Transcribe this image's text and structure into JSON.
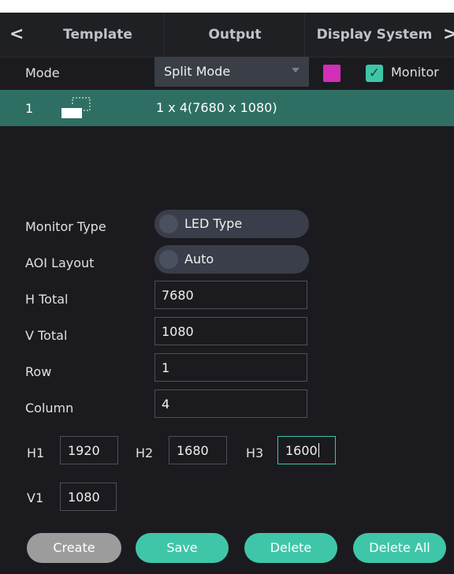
{
  "tabs": {
    "back_glyph": "<",
    "forward_glyph": ">",
    "items": [
      "Template",
      "Output",
      "Display System"
    ]
  },
  "mode": {
    "label": "Mode",
    "selected": "Split Mode",
    "color_swatch": "#d12fb8",
    "monitor_checked": true,
    "monitor_label": "Monitor"
  },
  "layout_list": {
    "rows": [
      {
        "index": "1",
        "description": "1 x 4(7680 x 1080)"
      }
    ]
  },
  "settings": {
    "monitor_type": {
      "label": "Monitor Type",
      "value": "LED Type"
    },
    "aoi_layout": {
      "label": "AOI Layout",
      "value": "Auto"
    },
    "h_total": {
      "label": "H Total",
      "value": "7680"
    },
    "v_total": {
      "label": "V Total",
      "value": "1080"
    },
    "row": {
      "label": "Row",
      "value": "1"
    },
    "column": {
      "label": "Column",
      "value": "4"
    }
  },
  "dimensions": {
    "h1": {
      "label": "H1",
      "value": "1920"
    },
    "h2": {
      "label": "H2",
      "value": "1680"
    },
    "h3": {
      "label": "H3",
      "value": "1600"
    },
    "v1": {
      "label": "V1",
      "value": "1080"
    }
  },
  "actions": {
    "create": "Create",
    "save": "Save",
    "delete": "Delete",
    "delete_all": "Delete All"
  },
  "colors": {
    "accent": "#3fc6a8",
    "selection": "#2f6f63",
    "background": "#1b1b1f"
  }
}
